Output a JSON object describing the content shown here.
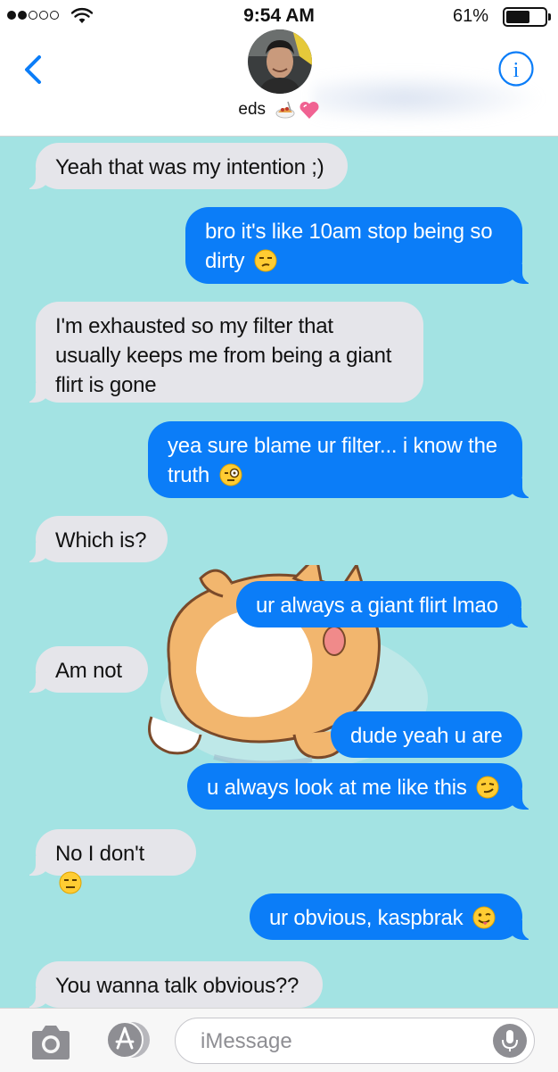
{
  "status_bar": {
    "time": "9:54 AM",
    "battery_percent": "61%",
    "battery_level": 0.61,
    "signal_bars_filled": 2,
    "signal_bars_total": 5
  },
  "header": {
    "contact_name": "eds",
    "contact_emojis": [
      "pasta-emoji",
      "heart-emoji"
    ]
  },
  "messages": [
    {
      "sender": "them",
      "text": "Yeah that was my intention ;)",
      "emoji": null
    },
    {
      "sender": "me",
      "line1": "bro it's like 10am stop being so",
      "text": "dirty",
      "emoji": "unamused-face"
    },
    {
      "sender": "them",
      "line1": "I'm exhausted so my filter that",
      "line2": "usually keeps me from being a giant",
      "text": "flirt is gone",
      "emoji": null
    },
    {
      "sender": "me",
      "line1": "yea sure blame ur filter... i know the",
      "text": "truth",
      "emoji": "monocle-face"
    },
    {
      "sender": "them",
      "text": "Which is?",
      "emoji": null
    },
    {
      "sender": "me",
      "text": "ur always a giant flirt lmao",
      "emoji": null
    },
    {
      "sender": "them",
      "text": "Am not",
      "emoji": null
    },
    {
      "sender": "me",
      "text": "dude yeah u are",
      "emoji": null
    },
    {
      "sender": "me",
      "text": "u always look at me like this",
      "emoji": "smirking-face"
    },
    {
      "sender": "them",
      "text": "No I don't",
      "emoji": "expressionless-face"
    },
    {
      "sender": "me",
      "text": "ur obvious, kaspbrak",
      "emoji": "winking-tongue-face"
    },
    {
      "sender": "them",
      "text": "You wanna talk obvious??",
      "emoji": null
    }
  ],
  "sticker": {
    "icon": "shiba-dog-sticker"
  },
  "input": {
    "placeholder": "iMessage",
    "value": ""
  },
  "colors": {
    "chat_background": "#a3e3e3",
    "outgoing_bubble": "#0b7df8",
    "incoming_bubble": "#e5e5ea",
    "accent": "#0b7df8"
  }
}
